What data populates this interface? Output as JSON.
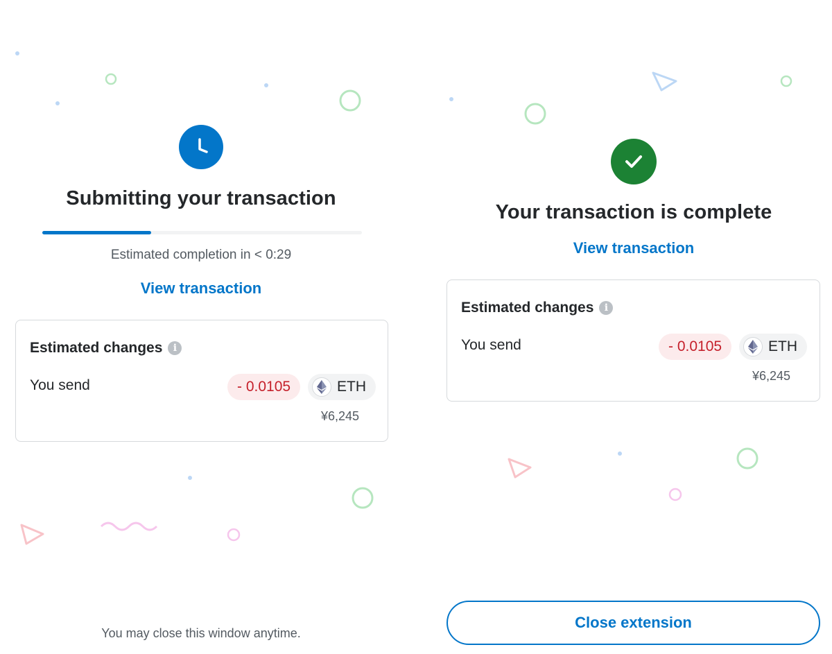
{
  "submitting": {
    "title": "Submitting your transaction",
    "progress_fraction": 0.34,
    "eta_text": "Estimated completion in < 0:29",
    "view_link": "View transaction",
    "changes": {
      "title": "Estimated changes",
      "send_label": "You send",
      "amount": "- 0.0105",
      "token": "ETH",
      "fiat": "¥6,245"
    },
    "footer_note": "You may close this window anytime."
  },
  "complete": {
    "title": "Your transaction is complete",
    "view_link": "View transaction",
    "changes": {
      "title": "Estimated changes",
      "send_label": "You send",
      "amount": "- 0.0105",
      "token": "ETH",
      "fiat": "¥6,245"
    },
    "close_button": "Close extension"
  },
  "icons": {
    "pending": "clock-icon",
    "success": "check-icon",
    "info": "info-icon",
    "token": "ethereum-icon"
  },
  "colors": {
    "primary": "#0376c9",
    "success": "#1c8234",
    "negative": "#c5202b",
    "negative_bg": "#fcebec"
  }
}
